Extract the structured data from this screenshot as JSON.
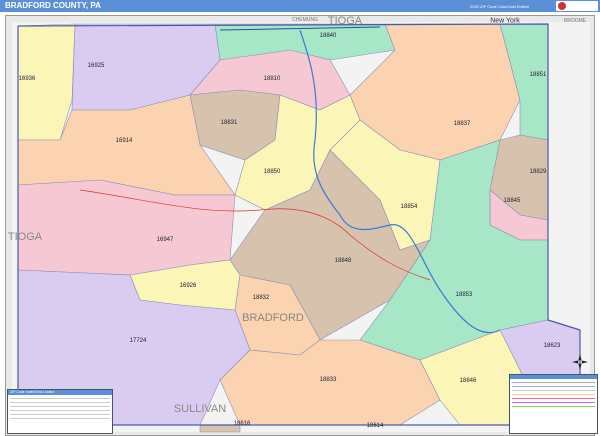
{
  "header": {
    "title": "BRADFORD COUNTY, PA",
    "edition": "2020 ZIP Code ColorCast Edition"
  },
  "neighbors": [
    {
      "name": "CHEMUNG"
    },
    {
      "name": "TIOGA"
    },
    {
      "name": "New York"
    },
    {
      "name": "BROOME"
    },
    {
      "name": "TIOGA"
    },
    {
      "name": "BRADFORD"
    },
    {
      "name": "SULLIVAN"
    }
  ],
  "zips": [
    {
      "zip": "18840",
      "color": "#a8e6c8"
    },
    {
      "zip": "16925",
      "color": "#d9ccf0"
    },
    {
      "zip": "16936",
      "color": "#fbf5b8"
    },
    {
      "zip": "18810",
      "color": "#f6c8d4"
    },
    {
      "zip": "18851",
      "color": "#a8e6c8"
    },
    {
      "zip": "18831",
      "color": "#d7c2ad"
    },
    {
      "zip": "18837",
      "color": "#fbd3b0"
    },
    {
      "zip": "16914",
      "color": "#fbd3b0"
    },
    {
      "zip": "18850",
      "color": "#fbf5b8"
    },
    {
      "zip": "18829",
      "color": "#d7c2ad"
    },
    {
      "zip": "18845",
      "color": "#f6c8d4"
    },
    {
      "zip": "18854",
      "color": "#fbf5b8"
    },
    {
      "zip": "16947",
      "color": "#f6c8d4"
    },
    {
      "zip": "18848",
      "color": "#d7c2ad"
    },
    {
      "zip": "16926",
      "color": "#fbf5b8"
    },
    {
      "zip": "18853",
      "color": "#a8e6c8"
    },
    {
      "zip": "18832",
      "color": "#fbd3b0"
    },
    {
      "zip": "17724",
      "color": "#d9ccf0"
    },
    {
      "zip": "18623",
      "color": "#d9ccf0"
    },
    {
      "zip": "18833",
      "color": "#fbd3b0"
    },
    {
      "zip": "18846",
      "color": "#fbf5b8"
    },
    {
      "zip": "18616",
      "color": "#d7c2ad"
    },
    {
      "zip": "18614",
      "color": "#d9ccf0"
    }
  ],
  "index": {
    "title": "ZIP Code Index/Grid Locator"
  },
  "colors": {
    "header": "#5b8fd6",
    "county_border": "#4a5aa8",
    "water": "#3a7bd5",
    "roads": "#d33"
  }
}
